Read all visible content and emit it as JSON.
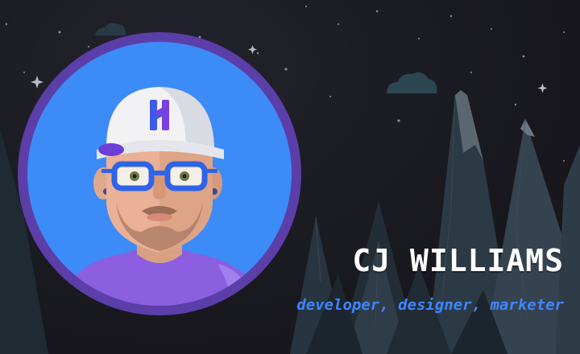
{
  "profile": {
    "name": "CJ WILLIAMS",
    "tagline": "developer, designer, marketer"
  },
  "colors": {
    "background": "#1a1a21",
    "avatar_ring": "#5b3ea8",
    "avatar_fill": "#3d8bf6",
    "accent_blue": "#3d86ff",
    "name_text": "#ffffff",
    "mountains": "#2c3a45"
  },
  "icons": {
    "avatar": "cartoon-avatar-illustration",
    "cap_logo": "cap-logo-icon"
  }
}
